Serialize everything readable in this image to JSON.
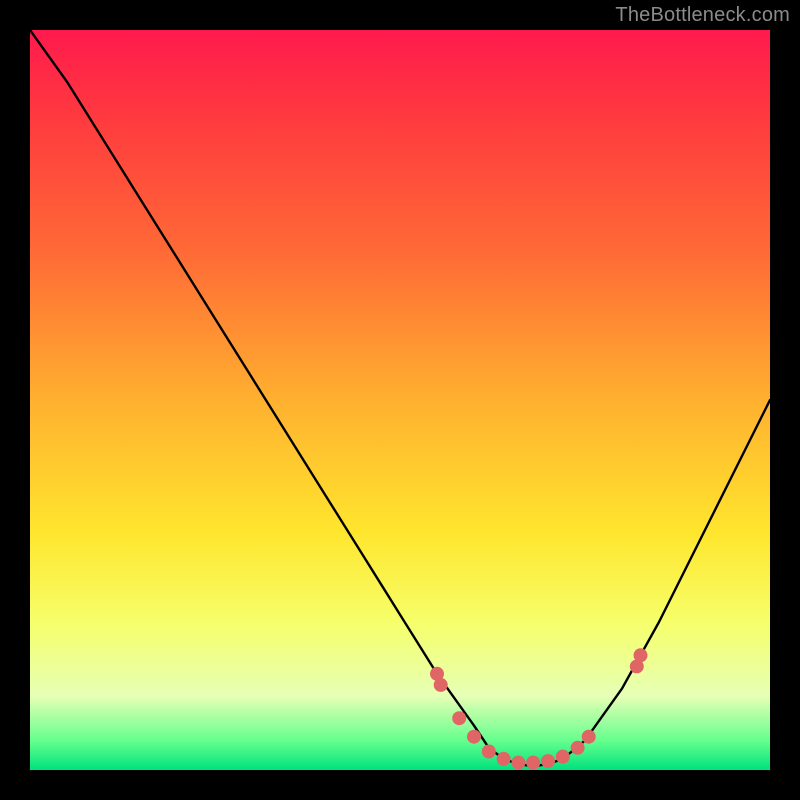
{
  "watermark": "TheBottleneck.com",
  "chart_data": {
    "type": "line",
    "title": "",
    "xlabel": "",
    "ylabel": "",
    "x_range": [
      0,
      100
    ],
    "y_range": [
      0,
      100
    ],
    "series": [
      {
        "name": "bottleneck-curve",
        "x": [
          0,
          5,
          10,
          15,
          20,
          25,
          30,
          35,
          40,
          45,
          50,
          55,
          60,
          62,
          64,
          66,
          68,
          70,
          72,
          75,
          80,
          85,
          90,
          95,
          100
        ],
        "y": [
          100,
          93,
          85,
          77,
          69,
          61,
          53,
          45,
          37,
          29,
          21,
          13,
          6,
          3,
          1.5,
          0.8,
          0.5,
          0.8,
          1.5,
          4,
          11,
          20,
          30,
          40,
          50
        ]
      }
    ],
    "markers": {
      "name": "highlight-points",
      "color": "#e06666",
      "radius_px": 7,
      "x": [
        55,
        55.5,
        58,
        60,
        62,
        64,
        66,
        68,
        70,
        72,
        74,
        75.5,
        82,
        82.5
      ],
      "y": [
        13,
        11.5,
        7,
        4.5,
        2.5,
        1.5,
        1,
        1,
        1.2,
        1.8,
        3,
        4.5,
        14,
        15.5
      ]
    },
    "gradient_stops": [
      {
        "pos": 0.0,
        "color": "#ff1a4d"
      },
      {
        "pos": 0.12,
        "color": "#ff3a3f"
      },
      {
        "pos": 0.3,
        "color": "#ff6a36"
      },
      {
        "pos": 0.5,
        "color": "#ffb02f"
      },
      {
        "pos": 0.68,
        "color": "#ffe62e"
      },
      {
        "pos": 0.8,
        "color": "#f6ff6a"
      },
      {
        "pos": 0.9,
        "color": "#e6ffb5"
      },
      {
        "pos": 0.96,
        "color": "#66ff8e"
      },
      {
        "pos": 1.0,
        "color": "#00e27d"
      }
    ]
  }
}
